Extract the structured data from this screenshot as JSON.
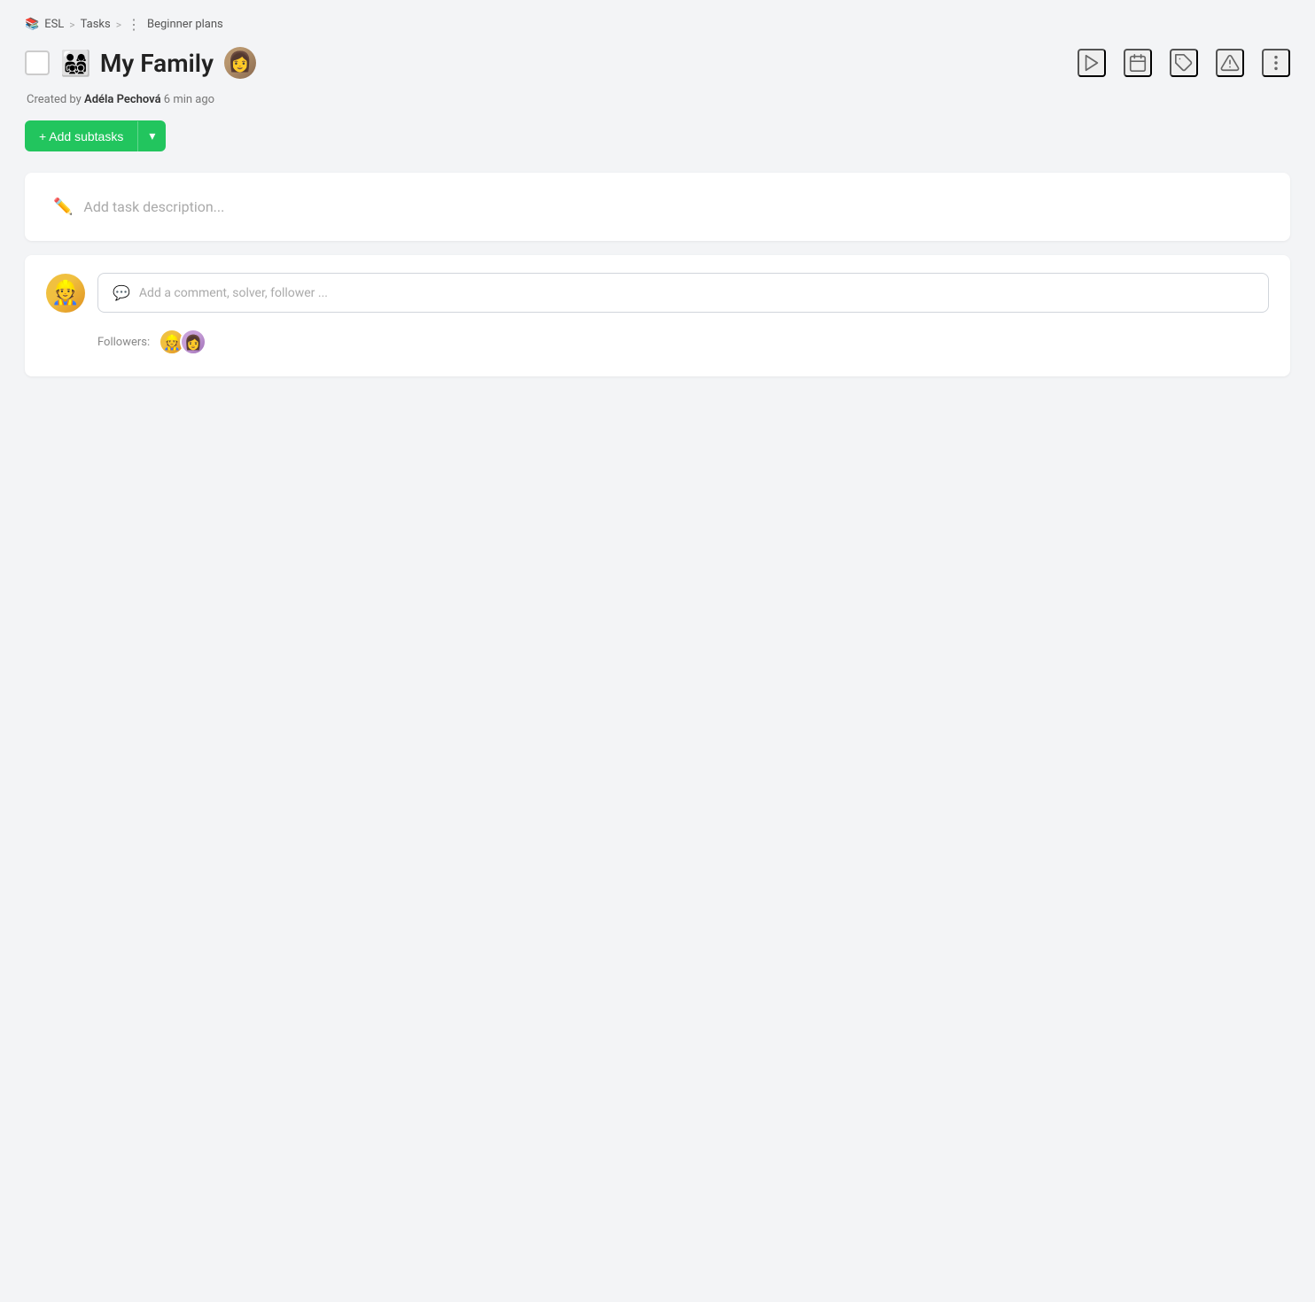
{
  "breadcrumb": {
    "app_emoji": "📚",
    "app_name": "ESL",
    "sep1": ">",
    "tasks_label": "Tasks",
    "sep2": ">",
    "dots": "⋮",
    "page_name": "Beginner plans"
  },
  "header": {
    "task_emoji": "👨‍👩‍👧‍👦",
    "task_title": "My Family",
    "play_icon": "play",
    "calendar_icon": "calendar",
    "tag_icon": "tag",
    "alert_icon": "alert",
    "more_icon": "more"
  },
  "meta": {
    "created_by_prefix": "Created by",
    "creator_name": "Adéla Pechová",
    "created_time": "6 min ago"
  },
  "add_subtasks": {
    "plus_label": "+ Add subtasks",
    "dropdown_arrow": "▾"
  },
  "description": {
    "placeholder": "Add task description..."
  },
  "comments": {
    "input_placeholder": "Add a comment, solver, follower ...",
    "followers_label": "Followers:"
  }
}
